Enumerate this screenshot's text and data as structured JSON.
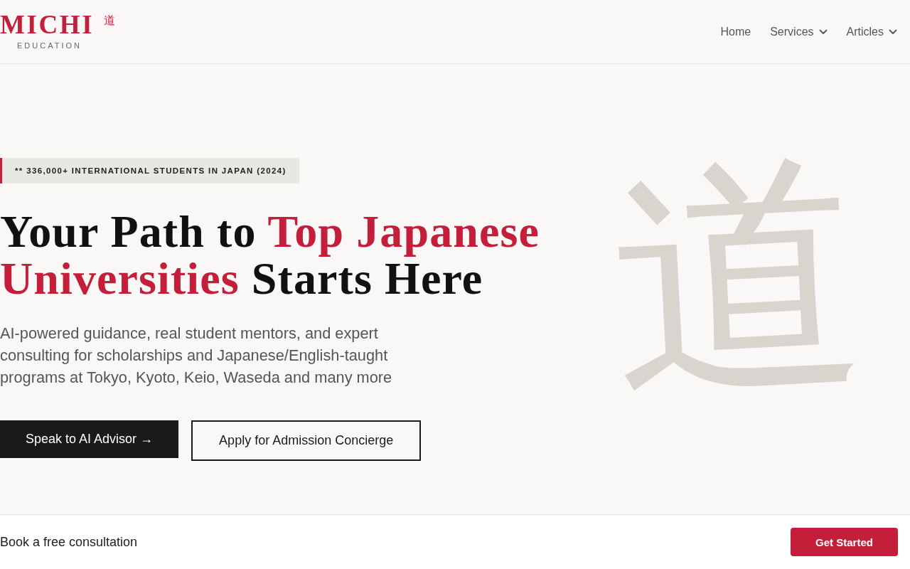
{
  "header": {
    "logo": {
      "wordmark": "MICHI",
      "kanji": "道",
      "tagline": "EDUCATION"
    },
    "nav": [
      {
        "label": "Home",
        "kind": "link"
      },
      {
        "label": "Services",
        "kind": "dropdown"
      },
      {
        "label": "Articles",
        "kind": "dropdown"
      }
    ]
  },
  "hero": {
    "badge": "** 336,000+ INTERNATIONAL STUDENTS IN JAPAN (2024)",
    "heading": [
      {
        "text": "Your Path to ",
        "accent": false
      },
      {
        "text": "Top Japanese Universities",
        "accent": true
      },
      {
        "text": " Starts Here",
        "accent": false
      }
    ],
    "subtitle": "AI-powered guidance, real student mentors, and expert consulting for scholarships and Japanese/English-taught programs at Tokyo, Kyoto, Keio, Waseda and many more",
    "buttons": [
      {
        "label": "Speak to AI Advisor →",
        "kind": "primary"
      },
      {
        "label": "Apply for Admission Concierge",
        "kind": "outline"
      }
    ],
    "background_glyph": "道"
  },
  "consultation_bar": {
    "text": "Book a free consultation",
    "button": "Get Started"
  }
}
